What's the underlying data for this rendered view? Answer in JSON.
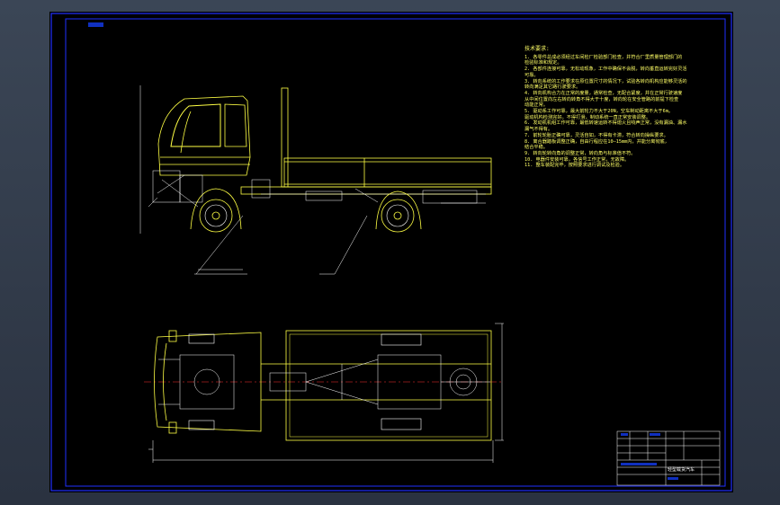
{
  "drawing": {
    "tech_requirements_title": "技术要求:",
    "tech_requirements": [
      "1. 各零件总成必须经过车间检厂检验部门检查，并符合厂里质量管理部门的",
      "   检验标准和规定。",
      "2. 各部件连接可靠，无松动现象，工作中确保不会脱，转向垂直运转完好灵活",
      "   可靠。",
      "3. 转向系统的工作要求在原位置尺寸的情况下，试验各转向机构应能够灵活的",
      "   转向满足其它路行驶要求。",
      "4. 转向机构合力在正常的度量，通常检查，无配合紧度，并在正常行驶速度",
      "   从中间位置向左右转向转角不得大于十度，转向轮在安全管路的前提下检查",
      "   动能正常。",
      "5. 驱动系工作可靠，最大前轮力不大于20N，空车制动距离不大于6m。",
      "   驱动机构检测完好。不得打滑，制动系统一直正常安装调整。",
      "6. 发动机机组工作可靠，最低转速运转不得熄火且响声正常，没有漏油、漏水",
      "   漏气不得有。",
      "7. 前轮轮胎正确可靠，灵活自如，不得有卡滞，符合转向操纵要求。",
      "8. 离合器踏板调整正确，自由行程应在10—15mm内，并能分离彻底，",
      "   结合平稳。",
      "9. 转向轮转向角的调整正常，转向角与标准值不符。",
      "10. 电器件安装可靠，各信号工作正常，无故障。",
      "11. 整车装配完毕，按照要求进行调试及检验。"
    ],
    "title_block_main": "轻型载货汽车",
    "colors": {
      "background": "#000000",
      "frame": "#2030ff",
      "outline": "#ffff44",
      "detail": "#ffffff",
      "centerline": "#ff3030",
      "text": "#ffff66"
    }
  }
}
